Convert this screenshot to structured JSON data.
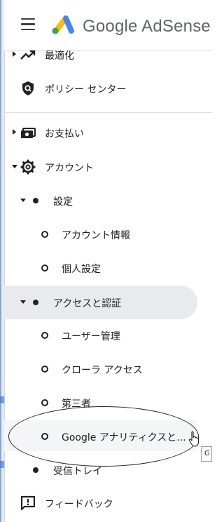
{
  "header": {
    "brand": "Google AdSense",
    "menu_icon": "hamburger-menu-icon",
    "logo_colors": [
      "#fbbc04",
      "#4285f4",
      "#34a853"
    ]
  },
  "nav": {
    "optimize": {
      "label": "最適化",
      "icon": "trending-up-icon"
    },
    "policy_center": {
      "label": "ポリシー センター",
      "icon": "shield-icon"
    },
    "payments": {
      "label": "お支払い",
      "icon": "payments-icon"
    },
    "account": {
      "label": "アカウント",
      "icon": "gear-icon"
    },
    "settings": {
      "label": "設定"
    },
    "account_info": {
      "label": "アカウント情報"
    },
    "personal_settings": {
      "label": "個人設定"
    },
    "access_auth": {
      "label": "アクセスと認証"
    },
    "user_management": {
      "label": "ユーザー管理"
    },
    "crawler_access": {
      "label": "クローラ アクセス"
    },
    "third_party": {
      "label": "第三者"
    },
    "google_analytics": {
      "label": "Google アナリティクスと..."
    },
    "inbox": {
      "label": "受信トレイ"
    },
    "feedback": {
      "label": "フィードバック",
      "icon": "feedback-icon"
    }
  },
  "tooltip": {
    "text": "G"
  },
  "colors": {
    "selected_bg": "#e8eaed",
    "divider": "#dadce0",
    "text": "#202124"
  }
}
